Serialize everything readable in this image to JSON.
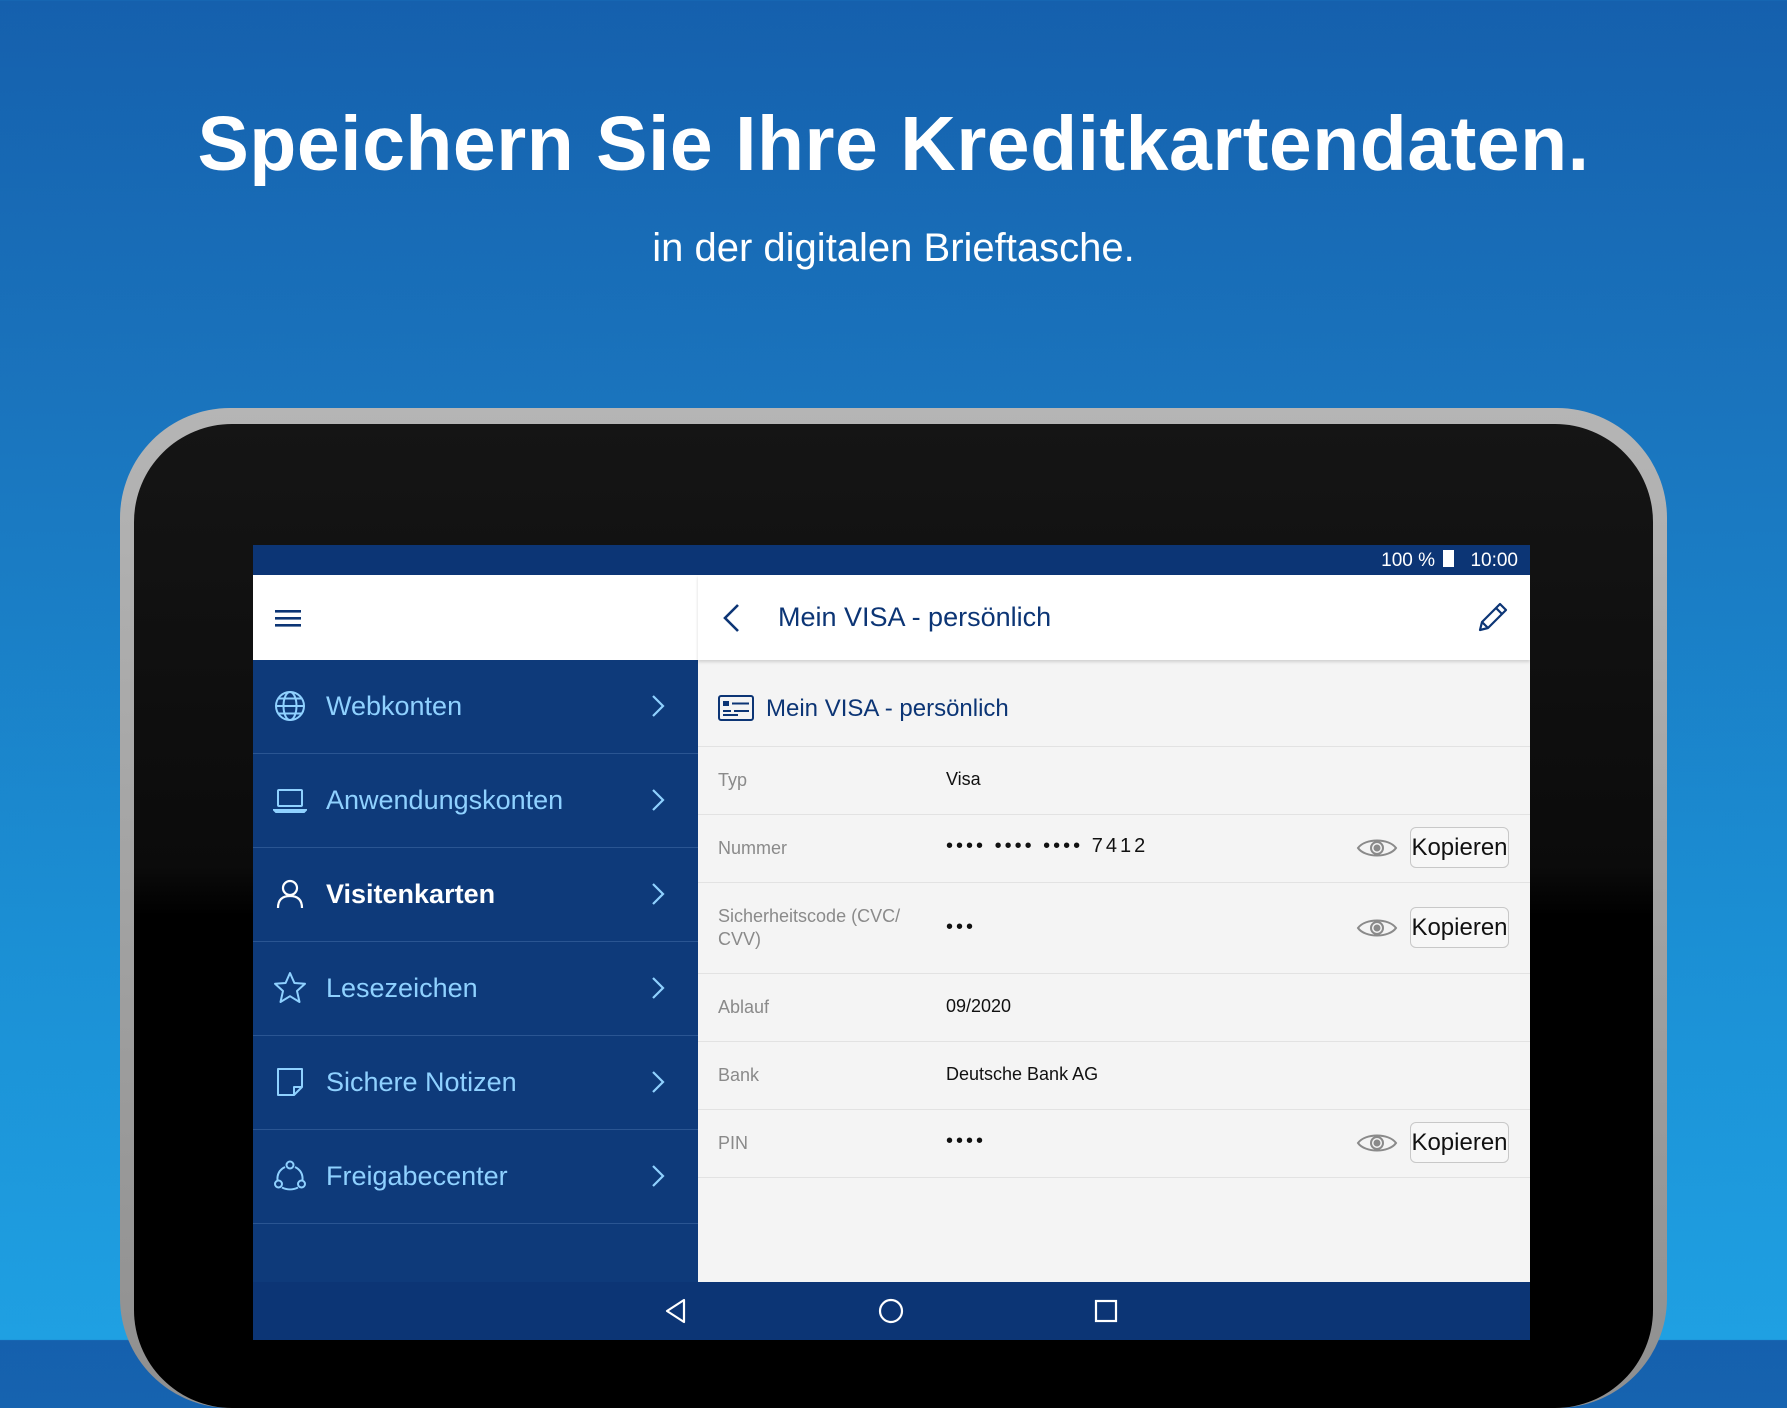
{
  "promo": {
    "headline": "Speichern Sie Ihre Kreditkartendaten.",
    "subline": "in der digitalen Brieftasche."
  },
  "status_bar": {
    "battery": "100 %",
    "time": "10:00"
  },
  "sidebar": {
    "items": [
      {
        "label": "Webkonten",
        "icon": "globe-icon",
        "active": false
      },
      {
        "label": "Anwendungskonten",
        "icon": "laptop-icon",
        "active": false
      },
      {
        "label": "Visitenkarten",
        "icon": "person-icon",
        "active": true
      },
      {
        "label": "Lesezeichen",
        "icon": "star-icon",
        "active": false
      },
      {
        "label": "Sichere Notizen",
        "icon": "note-icon",
        "active": false
      },
      {
        "label": "Freigabecenter",
        "icon": "share-icon",
        "active": false
      }
    ]
  },
  "detail": {
    "header_title": "Mein VISA - persönlich",
    "card_title": "Mein VISA - persönlich",
    "copy_label": "Kopieren",
    "fields": [
      {
        "label": "Typ",
        "value": "Visa"
      },
      {
        "label": "Nummer",
        "value": "•••• •••• •••• 7412"
      },
      {
        "label": "Sicherheitscode (CVC/ CVV)",
        "value": "•••"
      },
      {
        "label": "Ablauf",
        "value": "09/2020"
      },
      {
        "label": "Bank",
        "value": "Deutsche Bank AG"
      },
      {
        "label": "PIN",
        "value": "••••"
      }
    ]
  },
  "colors": {
    "app_bar": "#0c3575",
    "sidebar_bg": "#0e3a7a",
    "sidebar_text": "#8fd1ff",
    "title_text": "#0c3575"
  }
}
